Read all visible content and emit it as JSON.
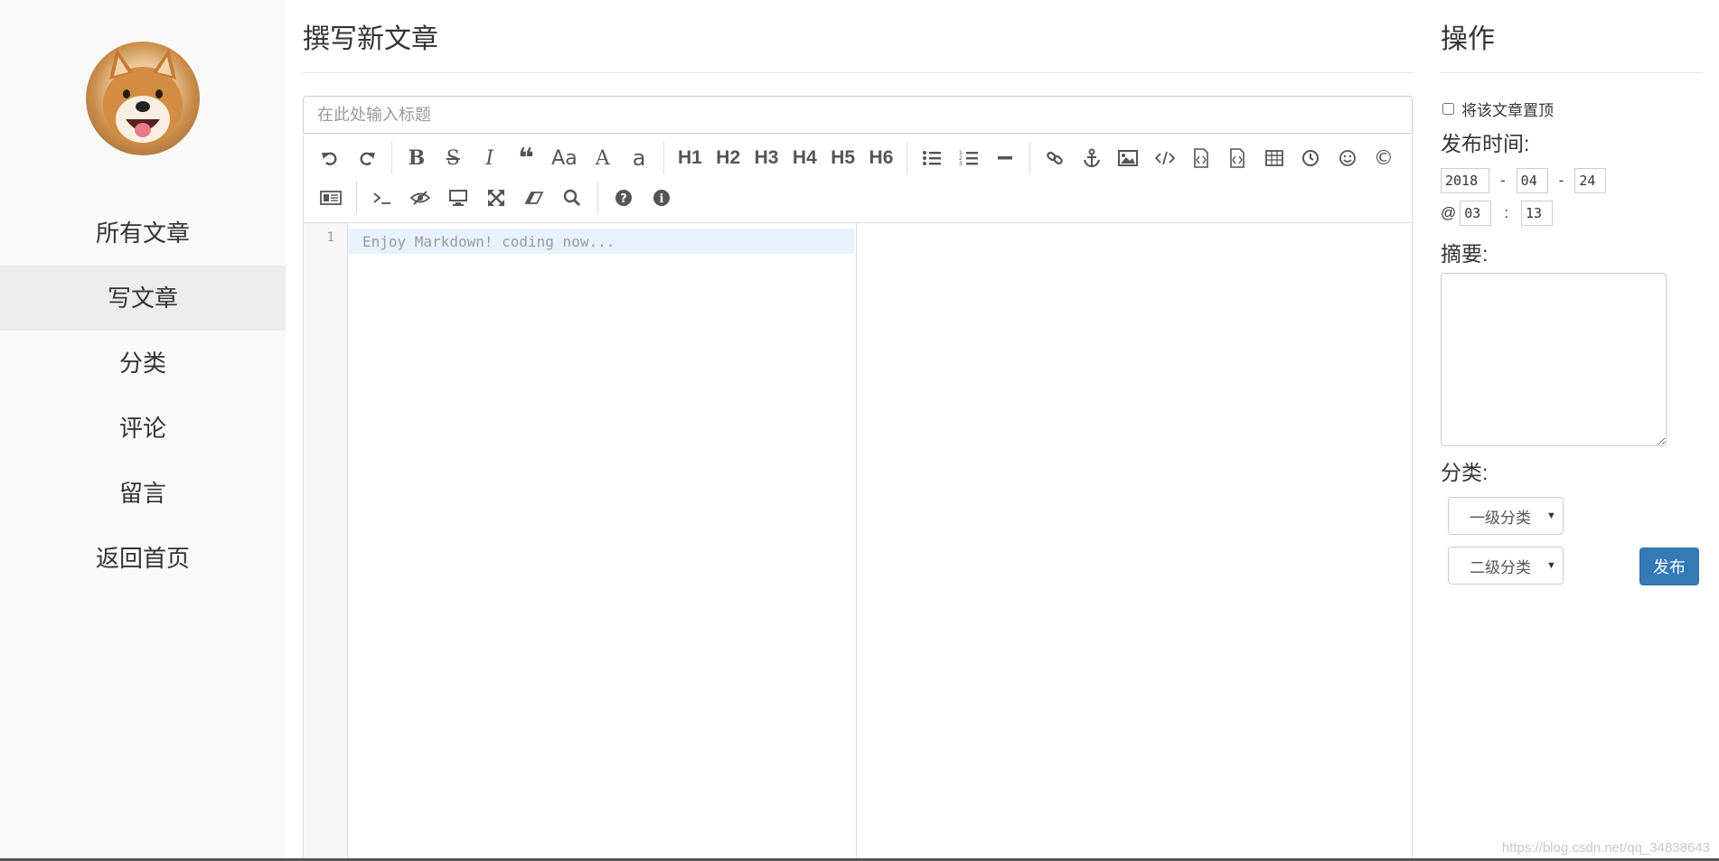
{
  "sidebar": {
    "items": [
      {
        "label": "所有文章",
        "active": false
      },
      {
        "label": "写文章",
        "active": true
      },
      {
        "label": "分类",
        "active": false
      },
      {
        "label": "评论",
        "active": false
      },
      {
        "label": "留言",
        "active": false
      },
      {
        "label": "返回首页",
        "active": false
      }
    ]
  },
  "main": {
    "title": "撰写新文章",
    "title_placeholder": "在此处输入标题",
    "toolbar": {
      "row1": [
        "undo-icon",
        "redo-icon",
        "|",
        "bold-icon",
        "strikethrough-icon",
        "italic-icon",
        "quote-icon",
        "uppercase-icon",
        "ucwords-icon",
        "lowercase-icon",
        "|",
        "H1",
        "H2",
        "H3",
        "H4",
        "H5",
        "H6",
        "|",
        "list-ul-icon",
        "list-ol-icon",
        "hr-icon",
        "|",
        "link-icon",
        "anchor-icon",
        "image-icon",
        "code-icon",
        "preformatted-code-icon",
        "code-block-icon",
        "table-icon",
        "datetime-icon",
        "emoji-icon",
        "html-entities-icon"
      ],
      "row2": [
        "pagebreak-icon",
        "|",
        "terminal-icon",
        "watch-toggle-icon",
        "preview-icon",
        "fullscreen-icon",
        "clear-icon",
        "search-icon",
        "|",
        "help-icon",
        "info-icon"
      ]
    },
    "editor": {
      "line_number": "1",
      "placeholder": "Enjoy Markdown! coding now..."
    }
  },
  "panel": {
    "title": "操作",
    "pin_label": "将该文章置顶",
    "publish_time_label": "发布时间:",
    "year": "2018",
    "month": "04",
    "day": "24",
    "at": "@",
    "hour": "03",
    "minute": "13",
    "date_sep": "-",
    "time_sep": ":",
    "summary_label": "摘要:",
    "category_label": "分类:",
    "category_1": "一级分类",
    "category_2": "二级分类",
    "publish_label": "发布"
  },
  "watermark": "https://blog.csdn.net/qq_34838643",
  "colors": {
    "sidebar_bg": "#f9f9f9",
    "active_nav_bg": "#ececec",
    "primary_button": "#337ab7",
    "active_line": "#e8f2fe"
  }
}
